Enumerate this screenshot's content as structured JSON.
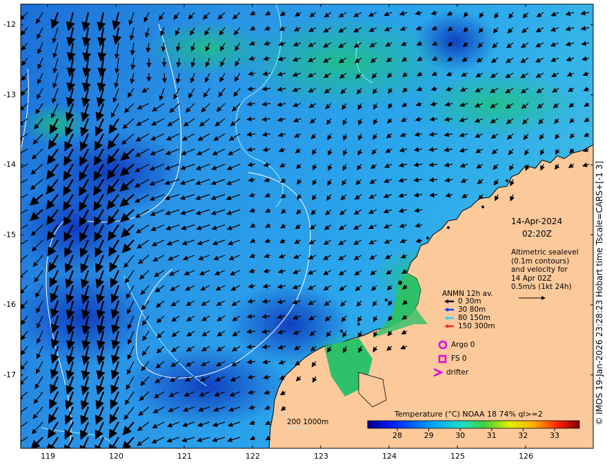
{
  "map": {
    "date": "14-Apr-2024",
    "time": "02:20Z",
    "velocity_note": [
      "Altimetric sealevel",
      "(0.1m contours)",
      "and velocity for",
      "14 Apr 02Z",
      "0.5m/s (1kt 24h)"
    ],
    "anmn_title": "ANMN 12h av.",
    "anmn_legend": [
      {
        "label": "0 30m",
        "color": "#000000"
      },
      {
        "label": "30 80m",
        "color": "#1a3cff"
      },
      {
        "label": "80 150m",
        "color": "#35d0ff"
      },
      {
        "label": "150 300m",
        "color": "#ff2a2a"
      }
    ],
    "argo_label": "Argo 0",
    "fs_label": "FS 0",
    "drifter_label": "drifter",
    "marker_color": "#e000e0",
    "depth_label": "200 1000m",
    "colorbar_title": "Temperature (°C) NOAA 18 74% ql>=2",
    "colorbar_ticks": [
      "28",
      "29",
      "30",
      "31",
      "32",
      "33"
    ],
    "credit": "© IMOS 19-Jan-2026 23:28:23 Hobart time Tscale=CARS+[-1 3]",
    "lat_ticks": [
      "-12",
      "-13",
      "-14",
      "-15",
      "-16",
      "-17"
    ],
    "lon_ticks": [
      "119",
      "120",
      "121",
      "122",
      "123",
      "124",
      "125",
      "126"
    ],
    "land_color": "#fcc99b",
    "coast_green": "#2fc06a"
  }
}
